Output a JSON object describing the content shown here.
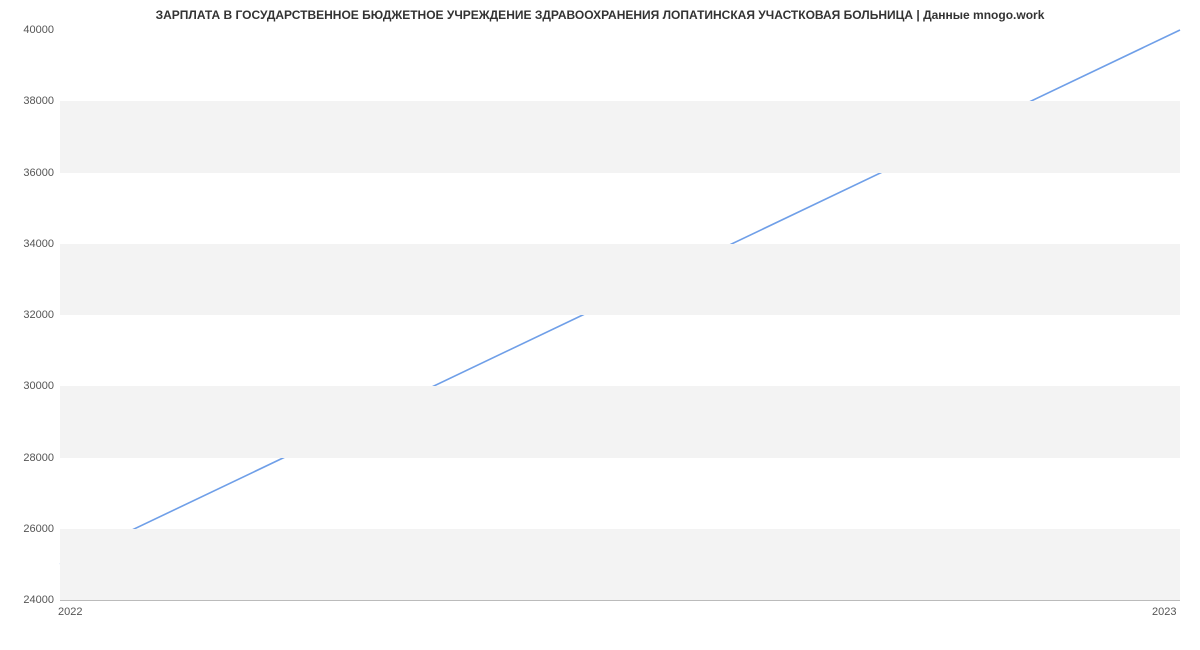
{
  "chart_data": {
    "type": "line",
    "title": "ЗАРПЛАТА В ГОСУДАРСТВЕННОЕ БЮДЖЕТНОЕ УЧРЕЖДЕНИЕ ЗДРАВООХРАНЕНИЯ ЛОПАТИНСКАЯ УЧАСТКОВАЯ БОЛЬНИЦА | Данные mnogo.work",
    "x": [
      "2022",
      "2023"
    ],
    "values": [
      25000,
      40000
    ],
    "xlabel": "",
    "ylabel": "",
    "ylim": [
      24000,
      40000
    ],
    "yticks": [
      24000,
      26000,
      28000,
      30000,
      32000,
      34000,
      36000,
      38000,
      40000
    ],
    "line_color": "#6f9fe8"
  }
}
